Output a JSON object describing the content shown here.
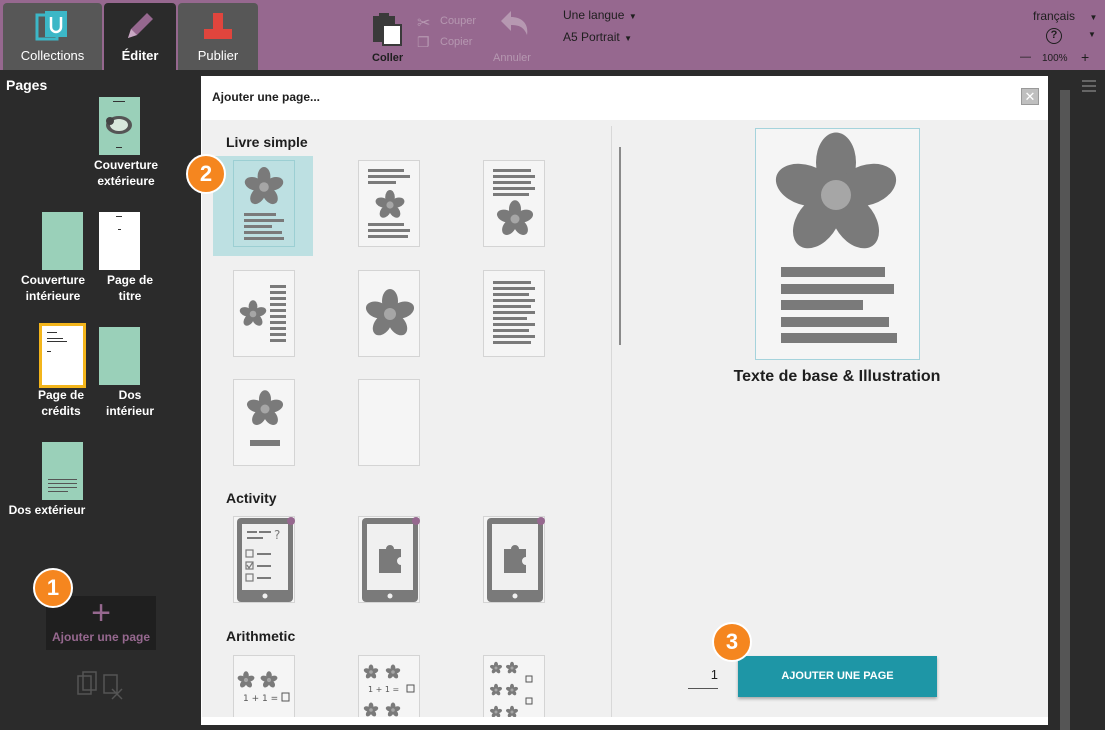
{
  "tabs": {
    "collections": "Collections",
    "edit": "Éditer",
    "publish": "Publier"
  },
  "toolbar": {
    "paste": "Coller",
    "cut": "Couper",
    "copy": "Copier",
    "undo": "Annuler",
    "language_mode": "Une langue",
    "page_size": "A5 Portrait",
    "ui_language": "français",
    "zoom": "100%",
    "zoom_minus": "—",
    "zoom_plus": "+",
    "help": "?"
  },
  "pages_panel": {
    "title": "Pages",
    "thumbs": [
      {
        "label": "Couverture extérieure"
      },
      {
        "label": "Couverture intérieure"
      },
      {
        "label": "Page de titre"
      },
      {
        "label": "Page de crédits"
      },
      {
        "label": "Dos intérieur"
      },
      {
        "label": "Dos extérieur"
      }
    ],
    "add_page": "Ajouter une page",
    "add_plus": "+"
  },
  "dialog": {
    "title": "Ajouter une page...",
    "close": "✕",
    "sections": {
      "simple": "Livre simple",
      "activity": "Activity",
      "arithmetic": "Arithmetic"
    },
    "preview_label": "Texte de base & Illustration",
    "count": "1",
    "add_button": "AJOUTER UNE PAGE"
  },
  "badges": [
    "1",
    "2",
    "3"
  ],
  "colors": {
    "accent": "#96688f",
    "button": "#1e96a6",
    "badge": "#f5861f",
    "thumb": "#9ad0b9"
  }
}
